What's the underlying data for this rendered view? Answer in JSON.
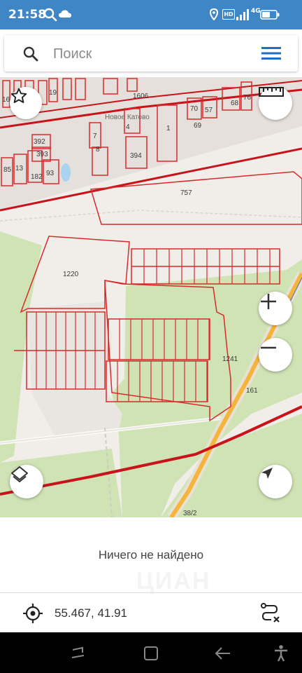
{
  "status_bar": {
    "time": "21:58",
    "network_label": "4G",
    "hd_label": "HD",
    "icons": [
      "search-icon",
      "cloud-icon",
      "location-icon",
      "hd-icon",
      "signal-icon",
      "battery-icon"
    ]
  },
  "search": {
    "placeholder": "Поиск",
    "icon": "search-icon",
    "menu_icon": "hamburger-menu-icon"
  },
  "map": {
    "labels": {
      "place_name": "Новое Катово",
      "road_number": "1606",
      "road_161": "161",
      "road_38": "38/2",
      "parcel_1": "1",
      "parcel_4": "4",
      "parcel_7": "7",
      "parcel_8": "8",
      "parcel_13": "13",
      "parcel_16": "16",
      "parcel_19": "19",
      "parcel_57": "57",
      "parcel_68": "68",
      "parcel_69": "69",
      "parcel_70": "70",
      "parcel_76": "76",
      "parcel_85": "85",
      "parcel_93": "93",
      "parcel_182": "182",
      "parcel_392": "392",
      "parcel_393": "393",
      "parcel_394": "394",
      "parcel_757": "757",
      "parcel_1220": "1220",
      "parcel_1241": "1241"
    },
    "colors": {
      "parcel_border": "#d62b2b",
      "boundary": "#c8131b",
      "green_area": "#cfe3b4",
      "road": "#f5b43c",
      "background": "#f1eeea"
    },
    "buttons": [
      "favorite-star-button",
      "ruler-button",
      "zoom-in-button",
      "zoom-out-button",
      "layers-button",
      "my-location-button"
    ]
  },
  "result": {
    "message": "Ничего не найдено",
    "watermark": "ЦИАН"
  },
  "coords": {
    "value": "55.467, 41.91",
    "icon": "target-icon",
    "route_icon": "route-clear-icon"
  },
  "nav_bar": {
    "buttons": [
      "recents-button",
      "home-button",
      "back-button",
      "accessibility-button"
    ]
  }
}
